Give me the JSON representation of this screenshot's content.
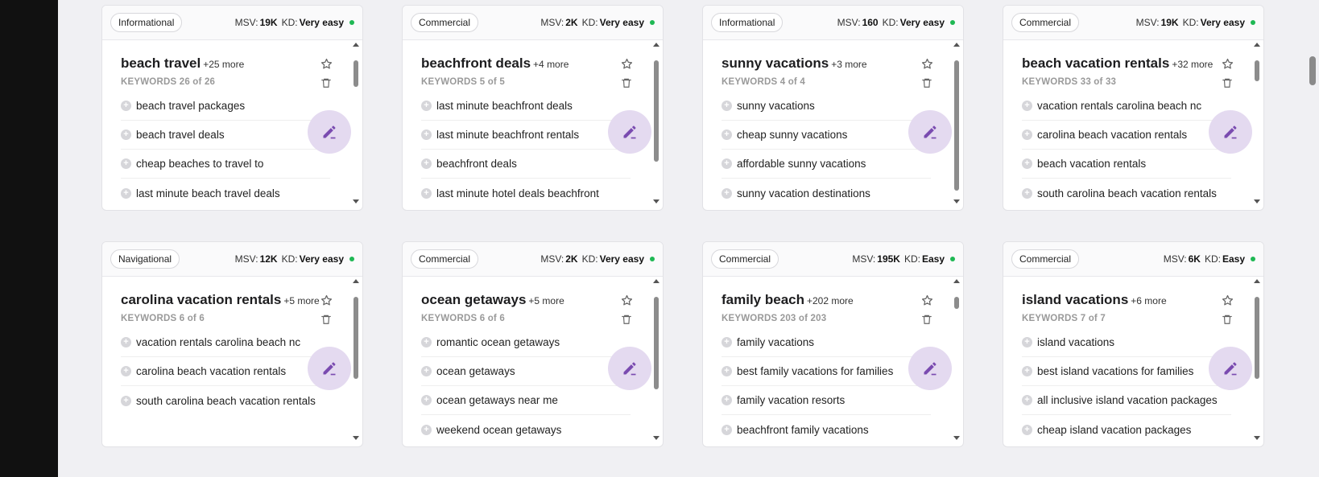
{
  "cards": [
    {
      "intent": "Informational",
      "msv_label": "MSV:",
      "msv": "19K",
      "kd_label": "KD:",
      "kd": "Very easy",
      "title": "beach travel",
      "more": "+25 more",
      "keyword_count": "KEYWORDS 26 of 26",
      "keywords": [
        "beach travel packages",
        "beach travel deals",
        "cheap beaches to travel to",
        "last minute beach travel deals"
      ]
    },
    {
      "intent": "Commercial",
      "msv_label": "MSV:",
      "msv": "2K",
      "kd_label": "KD:",
      "kd": "Very easy",
      "title": "beachfront deals",
      "more": "+4 more",
      "keyword_count": "KEYWORDS 5 of 5",
      "keywords": [
        "last minute beachfront deals",
        "last minute beachfront rentals",
        "beachfront deals",
        "last minute hotel deals beachfront"
      ]
    },
    {
      "intent": "Informational",
      "msv_label": "MSV:",
      "msv": "160",
      "kd_label": "KD:",
      "kd": "Very easy",
      "title": "sunny vacations",
      "more": "+3 more",
      "keyword_count": "KEYWORDS 4 of 4",
      "keywords": [
        "sunny vacations",
        "cheap sunny vacations",
        "affordable sunny vacations",
        "sunny vacation destinations"
      ]
    },
    {
      "intent": "Commercial",
      "msv_label": "MSV:",
      "msv": "19K",
      "kd_label": "KD:",
      "kd": "Very easy",
      "title": "beach vacation rentals",
      "more": "+32 more",
      "keyword_count": "KEYWORDS 33 of 33",
      "keywords": [
        "vacation rentals carolina beach nc",
        "carolina beach vacation rentals",
        "beach vacation rentals",
        "south carolina beach vacation rentals"
      ]
    },
    {
      "intent": "Navigational",
      "msv_label": "MSV:",
      "msv": "12K",
      "kd_label": "KD:",
      "kd": "Very easy",
      "title": "carolina vacation rentals",
      "more": "+5 more",
      "keyword_count": "KEYWORDS 6 of 6",
      "keywords": [
        "vacation rentals carolina beach nc",
        "carolina beach vacation rentals",
        "south carolina beach vacation rentals"
      ]
    },
    {
      "intent": "Commercial",
      "msv_label": "MSV:",
      "msv": "2K",
      "kd_label": "KD:",
      "kd": "Very easy",
      "title": "ocean getaways",
      "more": "+5 more",
      "keyword_count": "KEYWORDS 6 of 6",
      "keywords": [
        "romantic ocean getaways",
        "ocean getaways",
        "ocean getaways near me",
        "weekend ocean getaways"
      ]
    },
    {
      "intent": "Commercial",
      "msv_label": "MSV:",
      "msv": "195K",
      "kd_label": "KD:",
      "kd": "Easy",
      "title": "family beach",
      "more": "+202 more",
      "keyword_count": "KEYWORDS 203 of 203",
      "keywords": [
        "family vacations",
        "best family vacations for families",
        "family vacation resorts",
        "beachfront family vacations"
      ]
    },
    {
      "intent": "Commercial",
      "msv_label": "MSV:",
      "msv": "6K",
      "kd_label": "KD:",
      "kd": "Easy",
      "title": "island vacations",
      "more": "+6 more",
      "keyword_count": "KEYWORDS 7 of 7",
      "keywords": [
        "island vacations",
        "best island vacations for families",
        "all inclusive island vacation packages",
        "cheap island vacation packages"
      ]
    }
  ],
  "scroll_thumbs": [
    {
      "top": 0.08,
      "size": 0.18
    },
    {
      "top": 0.08,
      "size": 0.68
    },
    {
      "top": 0.08,
      "size": 0.87
    },
    {
      "top": 0.08,
      "size": 0.14
    },
    {
      "top": 0.08,
      "size": 0.55
    },
    {
      "top": 0.08,
      "size": 0.62
    },
    {
      "top": 0.08,
      "size": 0.08
    },
    {
      "top": 0.08,
      "size": 0.55
    }
  ],
  "colors": {
    "kd_dot": "#1fb854",
    "edit_button_bg": "#e4daf0",
    "edit_icon": "#7a4bb0"
  },
  "icons": {
    "star": "star-icon",
    "trash": "trash-icon",
    "edit": "pencil-icon",
    "add": "plus-icon"
  }
}
